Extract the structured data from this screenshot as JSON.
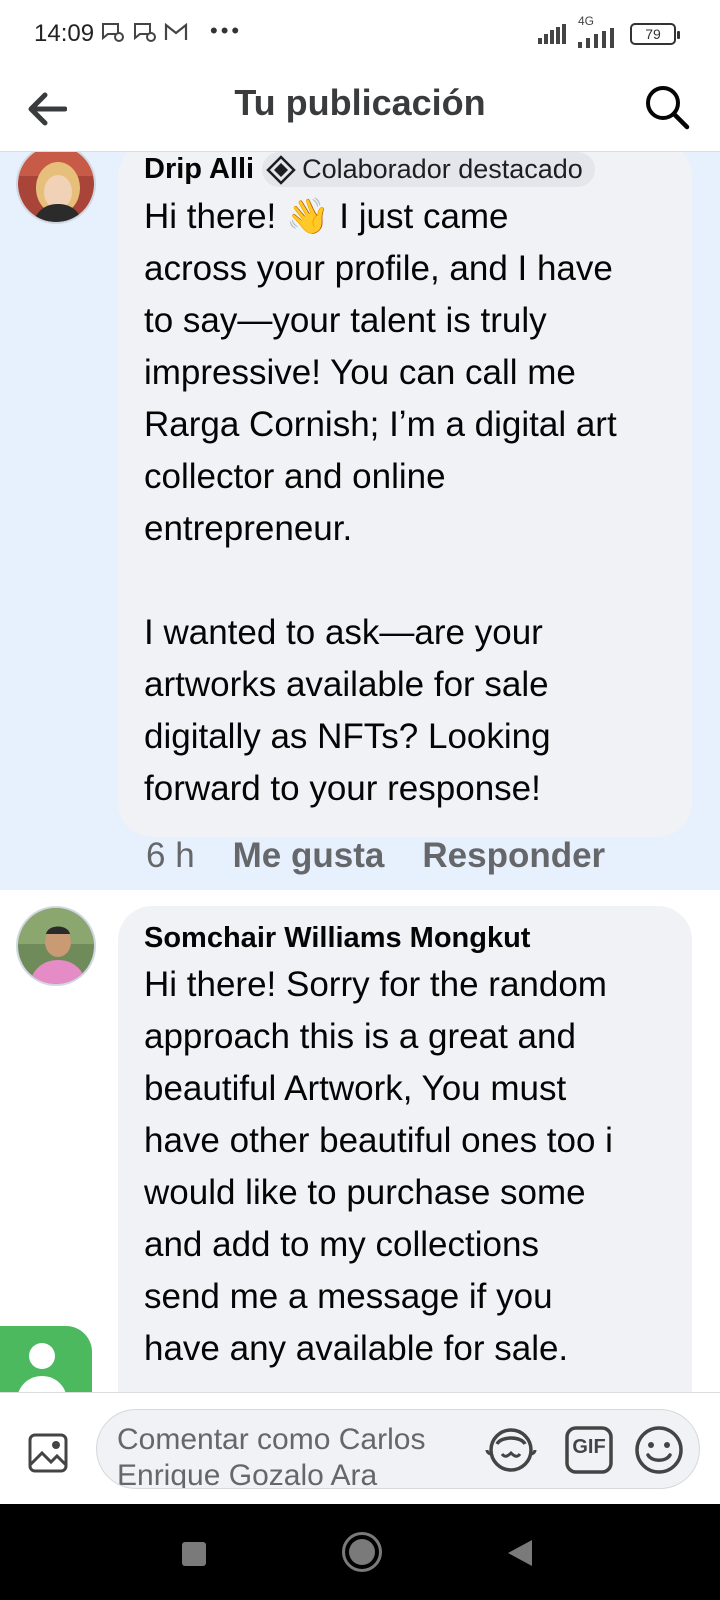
{
  "status_bar": {
    "time": "14:09",
    "network": "4G",
    "battery": "79",
    "more": "•••"
  },
  "header": {
    "title": "Tu publicación"
  },
  "comments": [
    {
      "author": "Drip Alli",
      "badge": "Colaborador destacado",
      "text": "Hi there! 👋 I just came\nacross your profile, and I have\nto say—your talent is truly\nimpressive! You can call me\nRarga Cornish; Iʼm a digital art\ncollector and online\nentrepreneur.\n\nI wanted to ask—are your\nartworks available for sale\ndigitally as NFTs? Looking\nforward to your response!",
      "time": "6 h",
      "like_label": "Me gusta",
      "reply_label": "Responder"
    },
    {
      "author": "Somchair Williams Mongkut",
      "text": "Hi there! Sorry for the random\napproach this is a great and\nbeautiful Artwork, You must\nhave other beautiful ones too i\nwould like to purchase some\nand add to my collections\nsend me a message if you\nhave any available for sale."
    }
  ],
  "composer": {
    "placeholder": "Comentar como Carlos Enrique Gozalo Ara",
    "gif_label": "GIF"
  },
  "colors": {
    "highlight_bg": "#e7f0fd",
    "bubble_bg": "#f0f2f5",
    "accent_green": "#4cb95f",
    "secondary_text": "#65676b"
  }
}
